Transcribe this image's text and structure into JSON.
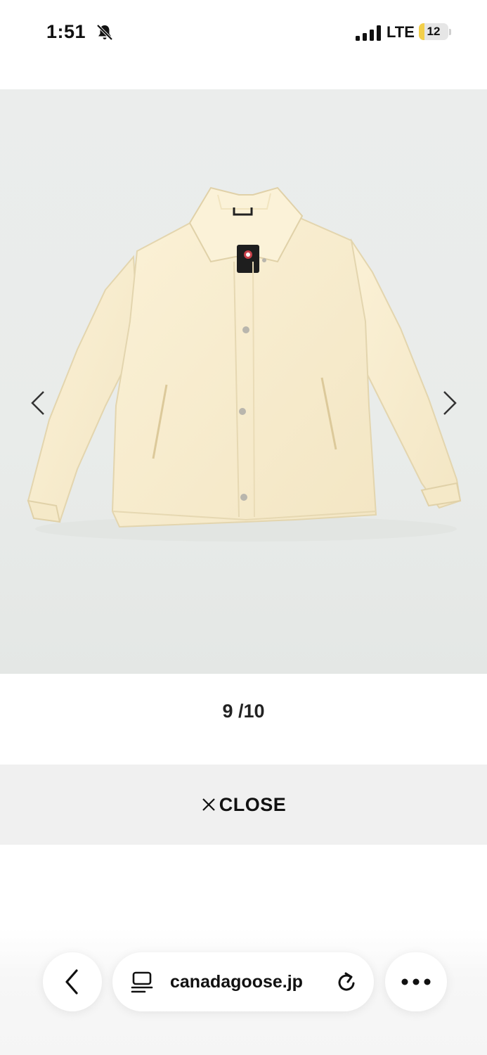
{
  "status_bar": {
    "time": "1:51",
    "network": "LTE",
    "battery_percent": "12",
    "battery_level": 0.12,
    "icons": [
      "bell-slash-icon",
      "signal-icon",
      "battery-icon"
    ]
  },
  "gallery": {
    "counter": "9 /10",
    "prev_icon": "chevron-left-icon",
    "next_icon": "chevron-right-icon"
  },
  "close": {
    "label": "CLOSE",
    "icon": "close-icon"
  },
  "browser": {
    "url": "canadagoose.jp",
    "icons": [
      "back-icon",
      "page-menu-icon",
      "reload-icon",
      "more-icon"
    ]
  },
  "colors": {
    "jacket": "#f7ecd0",
    "viewer_background": "#eceeed",
    "close_bar": "#f0f0f0",
    "battery_low": "#f2cf4a"
  }
}
